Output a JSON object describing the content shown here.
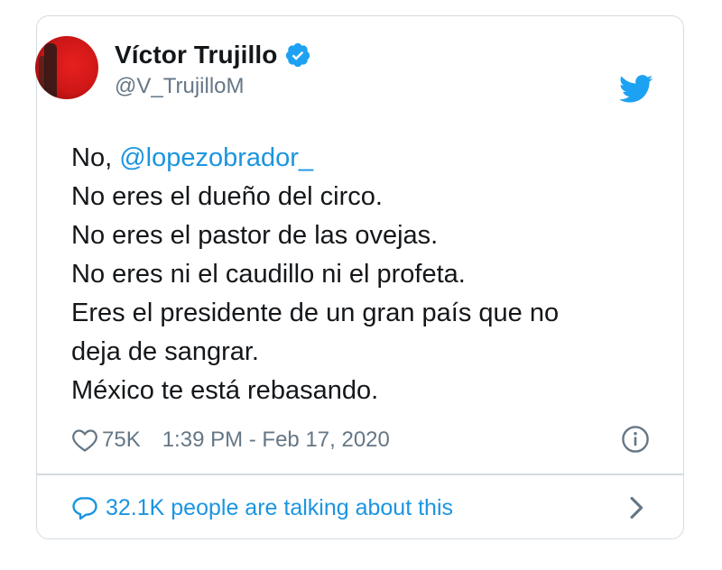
{
  "tweet": {
    "author": {
      "display_name": "Víctor Trujillo",
      "handle": "@V_TrujilloM",
      "verified": true
    },
    "text": {
      "line1_prefix": "No, ",
      "mention": "@lopezobrador_",
      "line2": "No eres el dueño del circo.",
      "line3": "No eres el pastor de las ovejas.",
      "line4": "No eres ni el caudillo ni el profeta.",
      "line5": "Eres el presidente de un gran país que no",
      "line6": "deja de sangrar.",
      "line7": "México te está rebasando."
    },
    "likes": "75K",
    "timestamp": "1:39 PM - Feb 17, 2020",
    "conversation": "32.1K people are talking about this"
  },
  "icons": {
    "brand": "twitter-bird-icon",
    "verified": "verified-badge-icon",
    "like": "heart-icon",
    "info": "info-icon",
    "reply": "speech-bubble-icon",
    "more": "chevron-right-icon"
  },
  "colors": {
    "link": "#1b95e0",
    "twitter_blue": "#1da1f2",
    "muted": "#657786",
    "text": "#14171a",
    "border": "#d4dbe1"
  }
}
